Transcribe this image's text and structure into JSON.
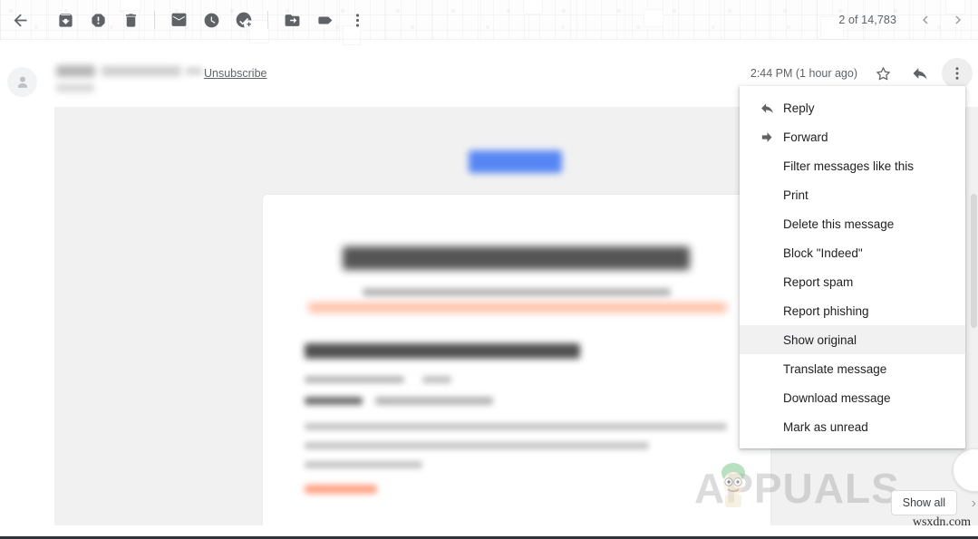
{
  "toolbar": {
    "back_label": "Back",
    "buttons": [
      {
        "name": "archive-button",
        "label": "Archive"
      },
      {
        "name": "report-spam-button",
        "label": "Report spam"
      },
      {
        "name": "delete-button",
        "label": "Delete"
      },
      {
        "name": "mark-unread-button",
        "label": "Mark as unread"
      },
      {
        "name": "snooze-button",
        "label": "Snooze"
      },
      {
        "name": "add-to-tasks-button",
        "label": "Add to Tasks"
      },
      {
        "name": "move-to-button",
        "label": "Move to"
      },
      {
        "name": "labels-button",
        "label": "Labels"
      },
      {
        "name": "more-options-button",
        "label": "More"
      }
    ],
    "counter": "2 of 14,783",
    "prev_label": "Newer",
    "next_label": "Older"
  },
  "message": {
    "unsubscribe_label": "Unsubscribe",
    "timestamp": "2:44 PM (1 hour ago)",
    "star_label": "Not starred",
    "reply_label": "Reply",
    "more_label": "More"
  },
  "menu": {
    "items": [
      {
        "label": "Reply",
        "icon": "reply-icon",
        "hovered": false
      },
      {
        "label": "Forward",
        "icon": "forward-icon",
        "hovered": false
      },
      {
        "label": "Filter messages like this",
        "icon": null,
        "hovered": false
      },
      {
        "label": "Print",
        "icon": null,
        "hovered": false
      },
      {
        "label": "Delete this message",
        "icon": null,
        "hovered": false
      },
      {
        "label": "Block \"Indeed\"",
        "icon": null,
        "hovered": false
      },
      {
        "label": "Report spam",
        "icon": null,
        "hovered": false
      },
      {
        "label": "Report phishing",
        "icon": null,
        "hovered": false
      },
      {
        "label": "Show original",
        "icon": null,
        "hovered": true
      },
      {
        "label": "Translate message",
        "icon": null,
        "hovered": false
      },
      {
        "label": "Download message",
        "icon": null,
        "hovered": false
      },
      {
        "label": "Mark as unread",
        "icon": null,
        "hovered": false
      }
    ]
  },
  "bottom": {
    "show_all_label": "Show all",
    "next_label": "›"
  },
  "watermarks": {
    "appuals": "APPUALS",
    "site": "wsxdn.com"
  },
  "colors": {
    "menu_hover": "#f1f1f1",
    "text_primary": "#202124",
    "text_secondary": "#5f6368",
    "body_bg": "#f1f1f1",
    "logo_blue": "#4a7ef5",
    "accent_orange": "#ff6a3c"
  }
}
